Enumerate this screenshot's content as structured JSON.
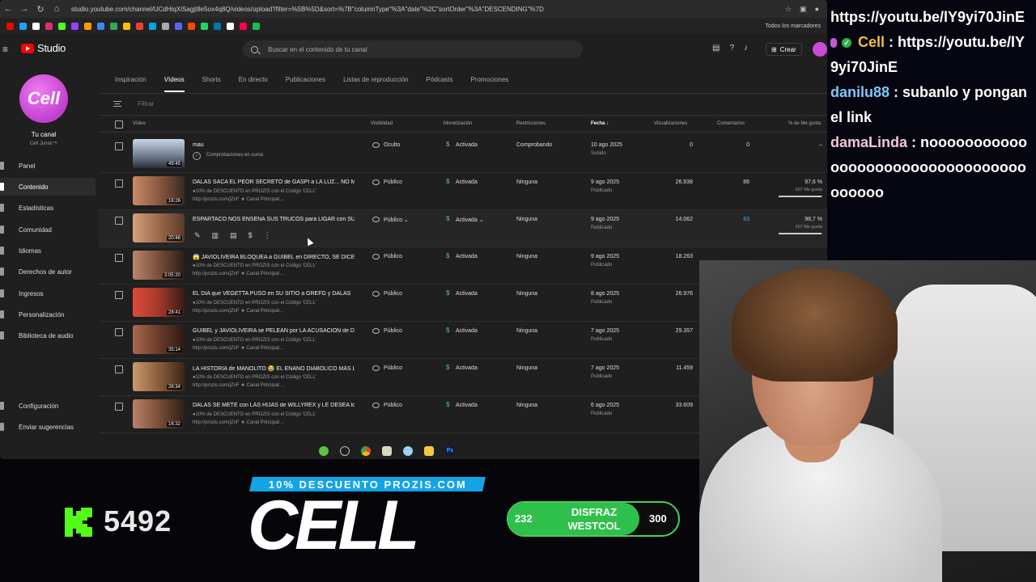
{
  "browser": {
    "url": "studio.youtube.com/channel/UCdHiqXiSagjt8e5ox4q8Q/videos/upload?filter=%5B%5D&sort=%7B\"columnType\"%3A\"date\"%2C\"sortOrder\"%3A\"DESCENDING\"%7D",
    "bookmarks_all": "Todos los marcadores"
  },
  "studio": {
    "logo": "Studio",
    "search_placeholder": "Buscar en el contenido de tu canal",
    "create_label": "Crear"
  },
  "sidebar": {
    "channel_name": "Tu canal",
    "channel_handle": "Cell Junior™",
    "avatar_text": "Cell",
    "items": [
      {
        "label": "Panel"
      },
      {
        "label": "Contenido"
      },
      {
        "label": "Estadísticas"
      },
      {
        "label": "Comunidad"
      },
      {
        "label": "Idiomas"
      },
      {
        "label": "Derechos de autor"
      },
      {
        "label": "Ingresos"
      },
      {
        "label": "Personalización"
      },
      {
        "label": "Biblioteca de audio"
      }
    ],
    "bottom": [
      {
        "label": "Configuración"
      },
      {
        "label": "Enviar sugerencias"
      }
    ],
    "active_index": 1
  },
  "tabs": [
    {
      "label": "Inspiración"
    },
    {
      "label": "Vídeos"
    },
    {
      "label": "Shorts"
    },
    {
      "label": "En directo"
    },
    {
      "label": "Publicaciones"
    },
    {
      "label": "Listas de reproducción"
    },
    {
      "label": "Pódcasts"
    },
    {
      "label": "Promociones"
    }
  ],
  "filter_placeholder": "Filtrar",
  "columns": {
    "video": "Vídeo",
    "visibility": "Visibilidad",
    "monetization": "Monetización",
    "restrictions": "Restricciones",
    "date": "Fecha",
    "views": "Visualizaciones",
    "comments": "Comentarios",
    "likes": "% de Me gusta"
  },
  "rows": [
    {
      "title": "mau",
      "desc1": "",
      "desc2": "",
      "checking": "Comprobaciones en curso",
      "duration": "49:45",
      "visibility": "Oculto",
      "monetization": "Activada",
      "restrictions": "Comprobando",
      "date": "10 ago 2025",
      "date_status": "Subido",
      "views": "0",
      "comments": "0",
      "likes": "–",
      "likes_sub": "",
      "likes_pct": 0,
      "thumb": "#6c7a8c"
    },
    {
      "title": "DALAS SACA EL PEOR SECRETO de GASPI a LA LUZ... NO M...",
      "desc1": "●10% de DESCUENTO en PROZIS con el Código 'CELL'",
      "desc2": "http://prozis.com/jZnF ★ Canal Principal:...",
      "duration": "16:26",
      "visibility": "Público",
      "monetization": "Activada",
      "restrictions": "Ninguna",
      "date": "9 ago 2025",
      "date_status": "Publicado",
      "views": "26.938",
      "comments": "86",
      "likes": "97,6 %",
      "likes_sub": "607 Me gusta",
      "likes_pct": 0.976,
      "thumb": "#8a5a3e"
    },
    {
      "title": "ESPARTACO NOS ENSEÑA SUS TRUCOS para LIGAR con SU ...",
      "desc1": "",
      "desc2": "",
      "duration": "20:46",
      "visibility": "Público",
      "monetization": "Activada",
      "restrictions": "Ninguna",
      "date": "9 ago 2025",
      "date_status": "Publicado",
      "views": "14.062",
      "comments": "83",
      "likes": "98,7 %",
      "likes_sub": "607 Me gusta",
      "likes_pct": 0.987,
      "thumb": "#9a6a4a"
    },
    {
      "title": "😱 JAVIOLIVEIRA BLOQUEA a GUIBEL en DIRECTO, SE DICEN ...",
      "desc1": "●10% de DESCUENTO en PROZIS con el Código 'CELL'",
      "desc2": "http://prozis.com/jZnF ★ Canal Principal:...",
      "duration": "3:05:20",
      "visibility": "Público",
      "monetization": "Activada",
      "restrictions": "Ninguna",
      "date": "9 ago 2025",
      "date_status": "Publicado",
      "views": "18.263",
      "comments": "",
      "likes": "",
      "likes_sub": "",
      "likes_pct": 0,
      "thumb": "#7a4f3a"
    },
    {
      "title": "EL DIA que VEGETTA PUSO en SU SITIO a GREFG y DALAS",
      "desc1": "●10% de DESCUENTO en PROZIS con el Código 'CELL'",
      "desc2": "http://prozis.com/jZnF ★ Canal Principal:...",
      "duration": "28:41",
      "visibility": "Público",
      "monetization": "Activada",
      "restrictions": "Ninguna",
      "date": "8 ago 2025",
      "date_status": "Publicado",
      "views": "26.976",
      "comments": "",
      "likes": "",
      "likes_sub": "",
      "likes_pct": 0,
      "thumb": "#a23a2a"
    },
    {
      "title": "GUIBEL y JAVIOLIVEIRA se PELEAN por LA ACUSACION de D...",
      "desc1": "●10% de DESCUENTO en PROZIS con el Código 'CELL'",
      "desc2": "http://prozis.com/jZnF ★ Canal Principal:...",
      "duration": "35:14",
      "visibility": "Público",
      "monetization": "Activada",
      "restrictions": "Ninguna",
      "date": "7 ago 2025",
      "date_status": "Publicado",
      "views": "29.357",
      "comments": "",
      "likes": "",
      "likes_sub": "",
      "likes_pct": 0,
      "thumb": "#6b3b2b"
    },
    {
      "title": "LA HISTORIA de MANOLITO 😂 EL ENANO DIABÓLICO MÁS L...",
      "desc1": "●10% de DESCUENTO en PROZIS con el Código 'CELL'",
      "desc2": "http://prozis.com/jZnF ★ Canal Principal:...",
      "duration": "26:34",
      "visibility": "Público",
      "monetization": "Activada",
      "restrictions": "Ninguna",
      "date": "7 ago 2025",
      "date_status": "Publicado",
      "views": "11.459",
      "comments": "",
      "likes": "",
      "likes_sub": "",
      "likes_pct": 0,
      "thumb": "#8c5d3c"
    },
    {
      "title": "DALAS SE METE con LAS HIJAS de WILLYREX y LE DESEA lo ...",
      "desc1": "●10% de DESCUENTO en PROZIS con el Código 'CELL'",
      "desc2": "http://prozis.com/jZnF ★ Canal Principal:...",
      "duration": "16:32",
      "visibility": "Público",
      "monetization": "Activada",
      "restrictions": "Ninguna",
      "date": "6 ago 2025",
      "date_status": "Publicado",
      "views": "33.609",
      "comments": "",
      "likes": "",
      "likes_sub": "",
      "likes_pct": 0,
      "thumb": "#7b4e38"
    }
  ],
  "chat": [
    {
      "user": "",
      "text": "https://youtu.be/lY9yi70JinE"
    },
    {
      "user": "Cell",
      "text": "https://youtu.be/lY9yi70JinE"
    },
    {
      "user": "danilu88",
      "text": "subanlo y pongan el link"
    },
    {
      "user": "damaLinda",
      "text": "nooooooooooooooooooooooooooooooooooooooo"
    }
  ],
  "overlay": {
    "promo": "10% DESCUENTO PROZIS.COM",
    "brand": "CELL",
    "kick_count": "5492",
    "goal_current": "232",
    "goal_name": "DISFRAZ WESTCOL",
    "goal_max": "300",
    "goal_fraction": 0.7733,
    "kick_color": "#53fc18",
    "promo_color": "#13a4e8"
  }
}
